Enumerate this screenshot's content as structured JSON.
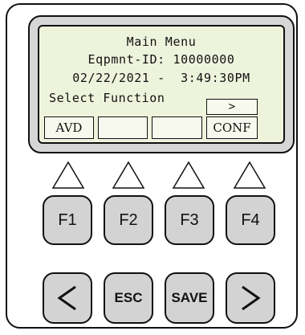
{
  "display": {
    "title": "Main Menu",
    "equipment_line": "Eqpmnt-ID: 10000000",
    "datetime_line": "02/22/2021 -  3:49:30PM",
    "prompt": "Select Function",
    "next_indicator": ">",
    "softkeys": [
      "AVD",
      "",
      "",
      "CONF"
    ]
  },
  "function_keys": [
    "F1",
    "F2",
    "F3",
    "F4"
  ],
  "nav_keys": {
    "left_icon": "chevron-left-icon",
    "esc_label": "ESC",
    "save_label": "SAVE",
    "right_icon": "chevron-right-icon"
  },
  "colors": {
    "key_fill": "#d3d3d3",
    "bezel_fill": "#d6d6d6",
    "screen_fill": "#eef3dc",
    "outline": "#111111"
  }
}
